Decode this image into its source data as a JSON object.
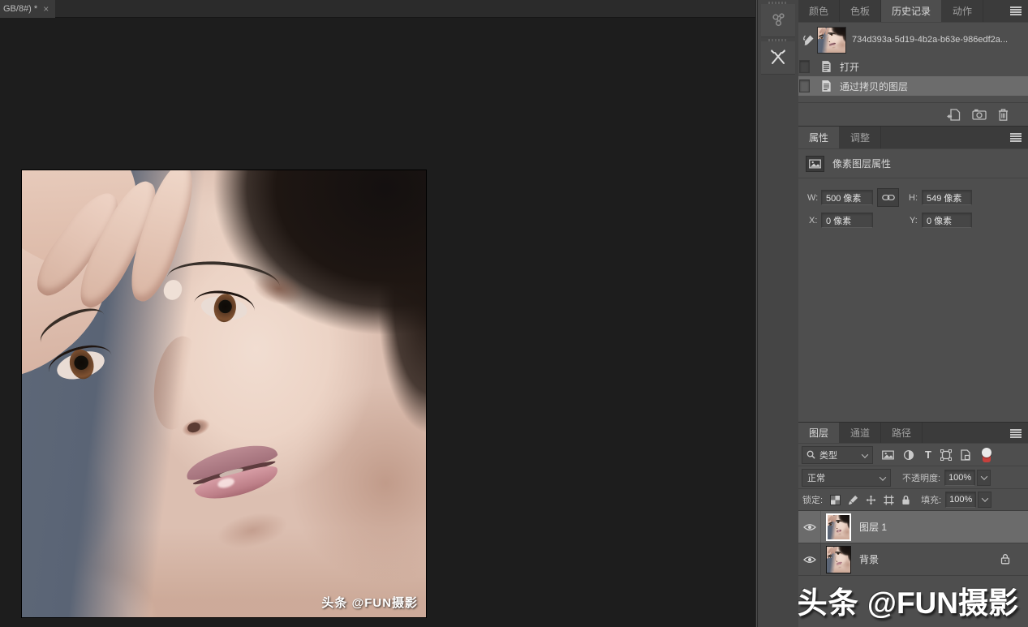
{
  "doc_tab": {
    "title": "GB/8#) *",
    "close_label": "×"
  },
  "history": {
    "tabs": {
      "colors": "颜色",
      "swatches": "色板",
      "history": "历史记录",
      "actions": "动作"
    },
    "snapshot_name": "734d393a-5d19-4b2a-b63e-986edf2a...",
    "state_open": "打开",
    "state_layer_via_copy": "通过拷贝的图层"
  },
  "properties": {
    "tabs": {
      "properties": "属性",
      "adjustments": "调整"
    },
    "header": "像素图层属性",
    "w_label": "W:",
    "w_value": "500 像素",
    "h_label": "H:",
    "h_value": "549 像素",
    "x_label": "X:",
    "x_value": "0 像素",
    "y_label": "Y:",
    "y_value": "0 像素"
  },
  "layers": {
    "tabs": {
      "layers": "图层",
      "channels": "通道",
      "paths": "路径"
    },
    "filter_kind": "类型",
    "type_filter_glyph": "T",
    "blend_mode": "正常",
    "opacity_label": "不透明度:",
    "opacity_value": "100%",
    "lock_label": "锁定:",
    "fill_label": "填充:",
    "fill_value": "100%",
    "layer1_name": "图层 1",
    "background_name": "背景"
  },
  "watermark": {
    "brand": "头条",
    "handle": " @FUN摄影"
  },
  "photo_watermark": {
    "text": "头条 @FUN摄影"
  },
  "colors": {
    "canvas_bg": "#1d1d1d",
    "panel_bg": "#4e4e4e",
    "tabbar_bg": "#3b3b3b",
    "selection_bg": "#6b6b6b",
    "toggle_red": "#c6403c"
  }
}
